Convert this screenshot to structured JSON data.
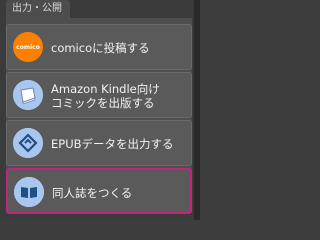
{
  "tab": {
    "label": "出力・公開"
  },
  "items": [
    {
      "label": "comicoに投稿する",
      "icon": "comico-logo-icon",
      "icon_text": "comico"
    },
    {
      "label": "Amazon  Kindle向け\nコミックを出版する",
      "icon": "kindle-book-icon"
    },
    {
      "label": "EPUBデータを出力する",
      "icon": "epub-icon"
    },
    {
      "label": "同人誌をつくる",
      "icon": "open-book-icon",
      "selected": true
    }
  ],
  "colors": {
    "selected_border": "#c2257c",
    "icon_bg": "#a9c7ee",
    "comico_orange": "#ff7f00"
  }
}
